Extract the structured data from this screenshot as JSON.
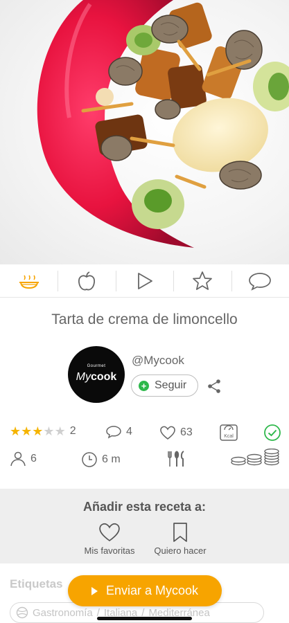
{
  "tabs": [
    {
      "icon": "cooking-pot-icon",
      "active": true
    },
    {
      "icon": "apple-icon",
      "active": false
    },
    {
      "icon": "play-icon",
      "active": false
    },
    {
      "icon": "star-icon",
      "active": false
    },
    {
      "icon": "comment-icon",
      "active": false
    }
  ],
  "recipe": {
    "title": "Tarta de crema de limoncello"
  },
  "author": {
    "handle": "@Mycook",
    "logo_small": "Gourmet",
    "logo_brand_a": "My",
    "logo_brand_b": "cook",
    "follow_label": "Seguir"
  },
  "stats": {
    "rating": 3,
    "rating_max": 5,
    "rating_count": "2",
    "comments": "4",
    "likes": "63",
    "kcal_label": "Kcal",
    "servings": "6",
    "time": "6 m"
  },
  "add_to": {
    "title": "Añadir esta receta a:",
    "favorites": "Mis favoritas",
    "want_to_make": "Quiero hacer"
  },
  "tags": {
    "title": "Etiquetas",
    "items": [
      "Gastronomía",
      "Italiana",
      "Mediterránea"
    ]
  },
  "send_button": {
    "label": "Enviar a Mycook"
  },
  "colors": {
    "accent": "#f7a400",
    "star": "#f5b400",
    "follow": "#2eb84b"
  }
}
